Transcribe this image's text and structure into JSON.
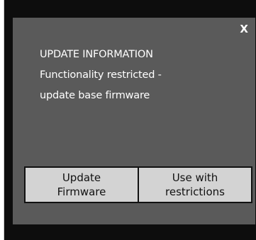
{
  "dialog": {
    "close_label": "X",
    "title": "UPDATE INFORMATION",
    "message_line1": "Functionality restricted -",
    "message_line2": "update base firmware"
  },
  "buttons": {
    "update": {
      "line1": "Update",
      "line2": "Firmware"
    },
    "restrict": {
      "line1": "Use with",
      "line2": "restrictions"
    }
  }
}
